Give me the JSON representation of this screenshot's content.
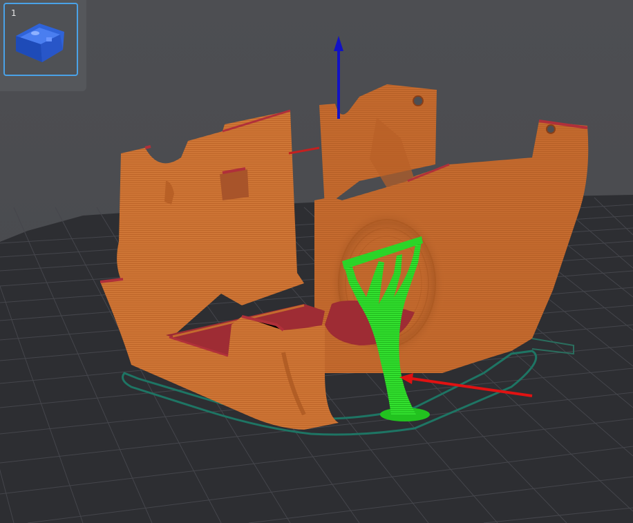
{
  "plate_list": {
    "plates": [
      {
        "number": "1",
        "selected": true
      }
    ]
  },
  "colors": {
    "background_top": "#4a4b4f",
    "bed_grid": "#2b2c30",
    "grid_lines": "#3a3b40",
    "model_orange": "#c46a2e",
    "overhang_red": "#b0303a",
    "support_green": "#2ee02e",
    "skirt_teal": "#1e6e60",
    "z_axis_blue": "#1010c8",
    "x_axis_red": "#e01010",
    "selection_blue": "#4aa2e8",
    "thumbnail_blue": "#2f63d8"
  },
  "icons": {
    "plate_thumbnail": "blue-enclosure-part-icon"
  }
}
